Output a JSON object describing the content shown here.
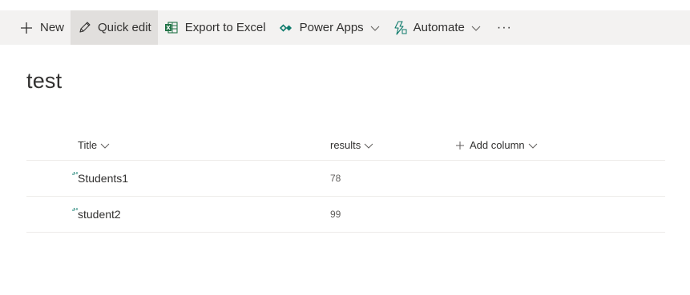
{
  "command_bar": {
    "new_label": "New",
    "quick_edit_label": "Quick edit",
    "export_label": "Export to Excel",
    "power_apps_label": "Power Apps",
    "automate_label": "Automate",
    "more_label": "···"
  },
  "list": {
    "title": "test",
    "columns": {
      "title": "Title",
      "results": "results",
      "add_column": "Add column"
    },
    "rows": [
      {
        "title": "Students1",
        "results": "78"
      },
      {
        "title": "student2",
        "results": "99"
      }
    ]
  },
  "colors": {
    "command_bar_bg": "#f3f2f1",
    "active_button_bg": "#e1dfdd",
    "accent_teal": "#0f7b6c",
    "excel_green": "#217346"
  },
  "icons": {
    "new": "plus-icon",
    "quick_edit": "pencil-icon",
    "export": "excel-icon",
    "power_apps": "power-apps-icon",
    "automate": "automate-icon",
    "new_item_marker": "new-item-sparkle-icon"
  }
}
